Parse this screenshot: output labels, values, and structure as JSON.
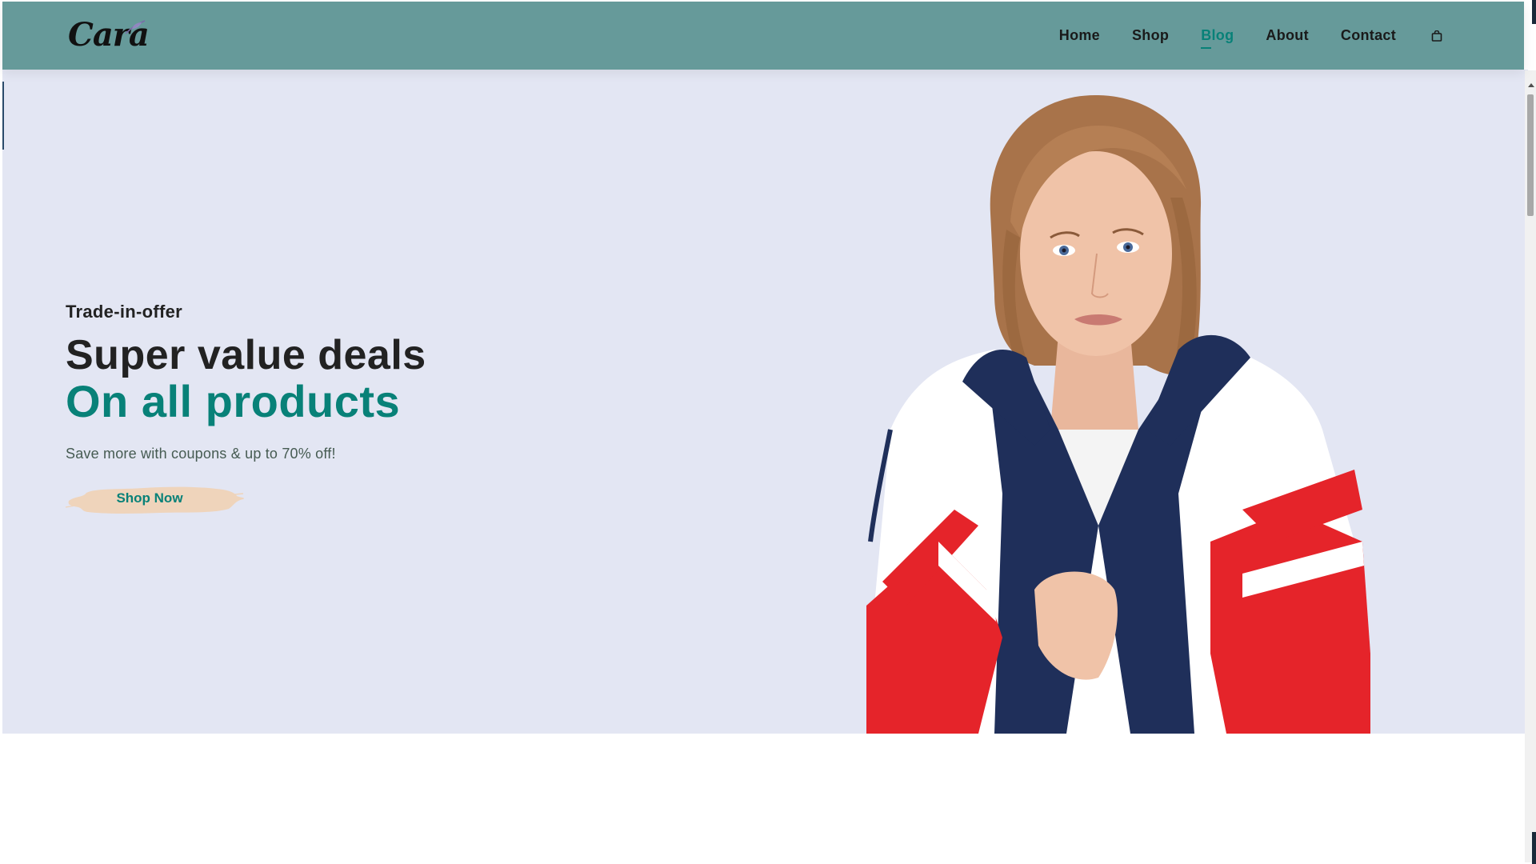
{
  "header": {
    "logo_text": "Cara",
    "nav": [
      {
        "label": "Home",
        "active": false
      },
      {
        "label": "Shop",
        "active": false
      },
      {
        "label": "Blog",
        "active": true
      },
      {
        "label": "About",
        "active": false
      },
      {
        "label": "Contact",
        "active": false
      }
    ],
    "cart_icon": "shopping-bag-icon"
  },
  "hero": {
    "kicker": "Trade-in-offer",
    "headline_line1": "Super value deals",
    "headline_line2": "On all products",
    "subtext": "Save more with coupons & up to 70% off!",
    "cta_label": "Shop Now",
    "image": "model-in-striped-windbreaker"
  },
  "colors": {
    "header_bg": "#669a9a",
    "hero_bg": "#e3e6f3",
    "accent": "#088178",
    "cta_brush": "#efd4bb",
    "text_dark": "#222222"
  }
}
